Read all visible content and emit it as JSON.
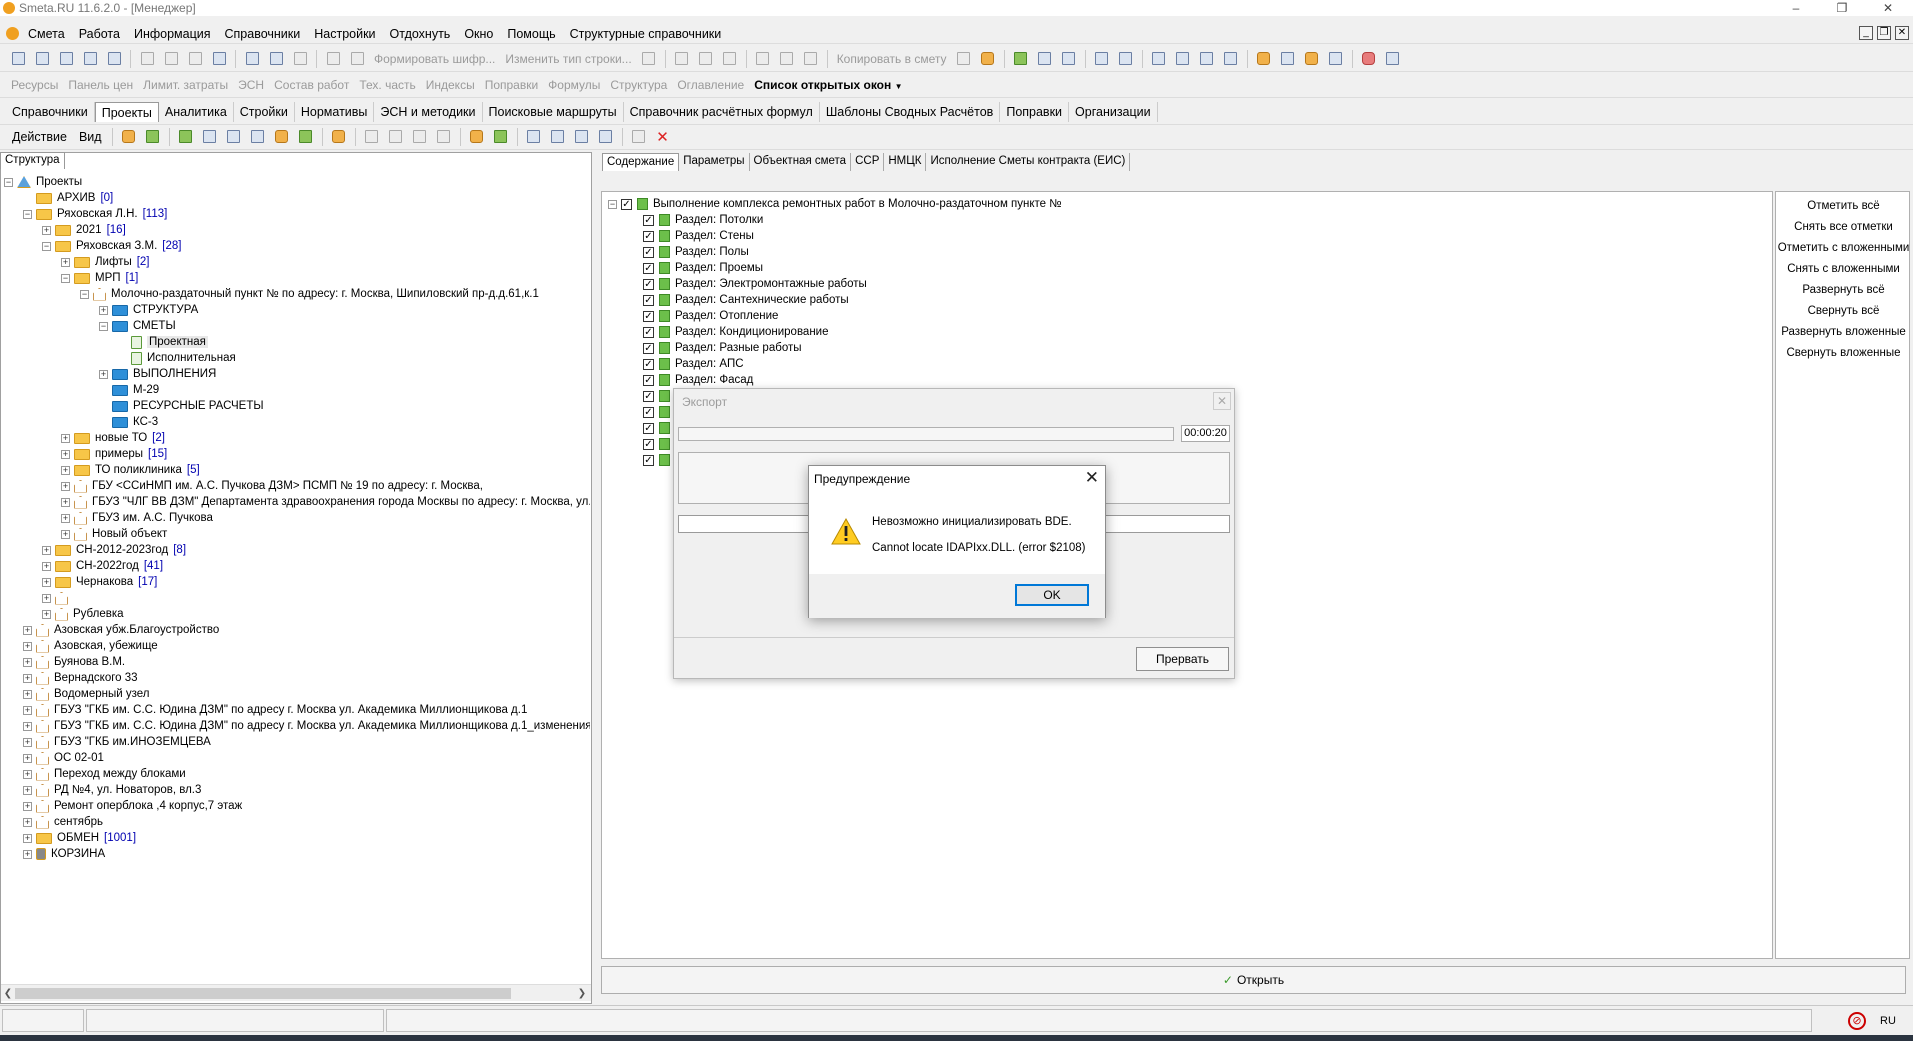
{
  "window": {
    "title": "Smeta.RU 11.6.2.0   - [Менеджер]",
    "minimize": "–",
    "restore": "❐",
    "close": "✕"
  },
  "menu": [
    "Смета",
    "Работа",
    "Информация",
    "Справочники",
    "Настройки",
    "Отдохнуть",
    "Окно",
    "Помощь",
    "Структурные справочники"
  ],
  "toolbar1": {
    "form_cipher": "Формировать шифр...",
    "change_row_type": "Изменить тип строки...",
    "copy_to_estimate": "Копировать в смету"
  },
  "toolbar2": {
    "items": [
      "Ресурсы",
      "Панель цен",
      "Лимит. затраты",
      "ЭСН",
      "Состав работ",
      "Тех. часть",
      "Индексы",
      "Поправки",
      "Формулы",
      "Структура",
      "Оглавление"
    ],
    "open_windows": "Список открытых окон"
  },
  "navtabs": [
    "Справочники",
    "Проекты",
    "Аналитика",
    "Стройки",
    "Нормативы",
    "ЭСН и методики",
    "Поисковые маршруты",
    "Справочник расчётных формул",
    "Шаблоны Сводных Расчётов",
    "Поправки",
    "Организации"
  ],
  "toolbar4": {
    "action": "Действие",
    "view": "Вид"
  },
  "structure_tab": "Структура",
  "tree": [
    {
      "label": "Проекты",
      "icon": "triangle",
      "lvl": 0,
      "exp": "-"
    },
    {
      "label": "АРХИВ",
      "count": "[0]",
      "icon": "folder",
      "lvl": 1,
      "exp": ""
    },
    {
      "label": "Ряховская Л.Н.",
      "count": "[113]",
      "icon": "folder",
      "lvl": 1,
      "exp": "-"
    },
    {
      "label": "2021",
      "count": "[16]",
      "icon": "folder",
      "lvl": 2,
      "exp": "+"
    },
    {
      "label": "Ряховская З.М.",
      "count": "[28]",
      "icon": "folder",
      "lvl": 2,
      "exp": "-"
    },
    {
      "label": "Лифты",
      "count": "[2]",
      "icon": "folder",
      "lvl": 3,
      "exp": "+"
    },
    {
      "label": "МРП",
      "count": "[1]",
      "icon": "folder",
      "lvl": 3,
      "exp": "-"
    },
    {
      "label": "Молочно-раздаточный пункт № по адресу: г. Москва, Шипиловский пр-д.д.61,к.1",
      "icon": "house",
      "lvl": 4,
      "exp": "-"
    },
    {
      "label": "СТРУКТУРА",
      "icon": "bluefolder",
      "lvl": 5,
      "exp": "+"
    },
    {
      "label": "СМЕТЫ",
      "icon": "bluefolder",
      "lvl": 5,
      "exp": "-"
    },
    {
      "label": "Проектная",
      "icon": "doc",
      "lvl": 6,
      "exp": "",
      "sel": true
    },
    {
      "label": "Исполнительная",
      "icon": "doc",
      "lvl": 6,
      "exp": ""
    },
    {
      "label": "ВЫПОЛНЕНИЯ",
      "icon": "bluefolder",
      "lvl": 5,
      "exp": "+"
    },
    {
      "label": "М-29",
      "icon": "bluefolder",
      "lvl": 5,
      "exp": ""
    },
    {
      "label": "РЕСУРСНЫЕ РАСЧЕТЫ",
      "icon": "bluefolder",
      "lvl": 5,
      "exp": ""
    },
    {
      "label": "КС-3",
      "icon": "bluefolder",
      "lvl": 5,
      "exp": ""
    },
    {
      "label": "новые ТО",
      "count": "[2]",
      "icon": "folder",
      "lvl": 3,
      "exp": "+"
    },
    {
      "label": "примеры",
      "count": "[15]",
      "icon": "folder",
      "lvl": 3,
      "exp": "+"
    },
    {
      "label": "ТО поликлиника",
      "count": "[5]",
      "icon": "folder",
      "lvl": 3,
      "exp": "+"
    },
    {
      "label": "ГБУ <ССиНМП им. А.С. Пучкова ДЗМ> ПСМП № 19 по адресу: г. Москва,",
      "icon": "house",
      "lvl": 3,
      "exp": "+"
    },
    {
      "label": "ГБУЗ \"ЧЛГ ВВ ДЗМ\" Департамента здравоохранения города Москвы по адресу: г. Москва, ул.",
      "icon": "house",
      "lvl": 3,
      "exp": "+"
    },
    {
      "label": "ГБУЗ им. А.С. Пучкова",
      "icon": "house",
      "lvl": 3,
      "exp": "+"
    },
    {
      "label": "Новый объект",
      "icon": "house",
      "lvl": 3,
      "exp": "+"
    },
    {
      "label": "СН-2012-2023год",
      "count": "[8]",
      "icon": "folder",
      "lvl": 2,
      "exp": "+"
    },
    {
      "label": "СН-2022год",
      "count": "[41]",
      "icon": "folder",
      "lvl": 2,
      "exp": "+"
    },
    {
      "label": "Чернакова",
      "count": "[17]",
      "icon": "folder",
      "lvl": 2,
      "exp": "+"
    },
    {
      "label": "",
      "icon": "house",
      "lvl": 2,
      "exp": "+"
    },
    {
      "label": "Рублевка",
      "icon": "house",
      "lvl": 2,
      "exp": "+"
    },
    {
      "label": "Азовская убж.Благоустройство",
      "icon": "house",
      "lvl": 1,
      "exp": "+"
    },
    {
      "label": "Азовская, убежище",
      "icon": "house",
      "lvl": 1,
      "exp": "+"
    },
    {
      "label": "Буянова В.М.",
      "icon": "house",
      "lvl": 1,
      "exp": "+"
    },
    {
      "label": "Вернадского 33",
      "icon": "house",
      "lvl": 1,
      "exp": "+"
    },
    {
      "label": "Водомерный узел",
      "icon": "house",
      "lvl": 1,
      "exp": "+"
    },
    {
      "label": "ГБУЗ \"ГКБ им. С.С. Юдина ДЗМ\" по адресу г. Москва  ул. Академика Миллионщикова д.1",
      "icon": "house",
      "lvl": 1,
      "exp": "+"
    },
    {
      "label": "ГБУЗ \"ГКБ им. С.С. Юдина ДЗМ\" по адресу г. Москва  ул. Академика Миллионщикова д.1_изменения",
      "icon": "house",
      "lvl": 1,
      "exp": "+"
    },
    {
      "label": "ГБУЗ \"ГКБ им.ИНОЗЕМЦЕВА",
      "icon": "house",
      "lvl": 1,
      "exp": "+"
    },
    {
      "label": "ОС 02-01",
      "icon": "house",
      "lvl": 1,
      "exp": "+"
    },
    {
      "label": "Переход между блоками",
      "icon": "house",
      "lvl": 1,
      "exp": "+"
    },
    {
      "label": "РД №4, ул. Новаторов, вл.3",
      "icon": "house",
      "lvl": 1,
      "exp": "+"
    },
    {
      "label": "Ремонт оперблока ,4 корпус,7 этаж",
      "icon": "house",
      "lvl": 1,
      "exp": "+"
    },
    {
      "label": "сентябрь",
      "icon": "house",
      "lvl": 1,
      "exp": "+"
    },
    {
      "label": "ОБМЕН",
      "count": "[1001]",
      "icon": "folder",
      "lvl": 1,
      "exp": "+"
    },
    {
      "label": "КОРЗИНА",
      "icon": "trash",
      "lvl": 1,
      "exp": "+"
    }
  ],
  "right_tabs": [
    "Содержание",
    "Параметры",
    "Объектная смета",
    "ССР",
    "НМЦК",
    "Исполнение Сметы контракта (ЕИС)"
  ],
  "content": {
    "root": "Выполнение комплекса ремонтных работ в Молочно-раздаточном пункте №",
    "sections": [
      "Раздел: Потолки",
      "Раздел: Стены",
      "Раздел: Полы",
      "Раздел: Проемы",
      "Раздел: Электромонтажные работы",
      "Раздел: Сантехнические работы",
      "Раздел: Отопление",
      "Раздел: Кондиционирование",
      "Раздел: Разные работы",
      "Раздел: АПС",
      "Раздел: Фасад",
      "",
      "",
      "",
      "",
      ""
    ]
  },
  "side_buttons": [
    "Отметить всё",
    "Снять все отметки",
    "Отметить с вложенными",
    "Снять с вложенными",
    "Развернуть всё",
    "Свернуть всё",
    "Развернуть вложенные",
    "Свернуть вложенные"
  ],
  "open_button": "Открыть",
  "status": {
    "lang": "RU"
  },
  "export_dialog": {
    "title": "Экспорт",
    "time": "00:00:20",
    "abort": "Прервать"
  },
  "warning_dialog": {
    "title": "Предупреждение",
    "line1": "Невозможно инициализировать BDE.",
    "line2": "Cannot locate IDAPIxx.DLL. (error $2108)",
    "ok": "OK"
  }
}
